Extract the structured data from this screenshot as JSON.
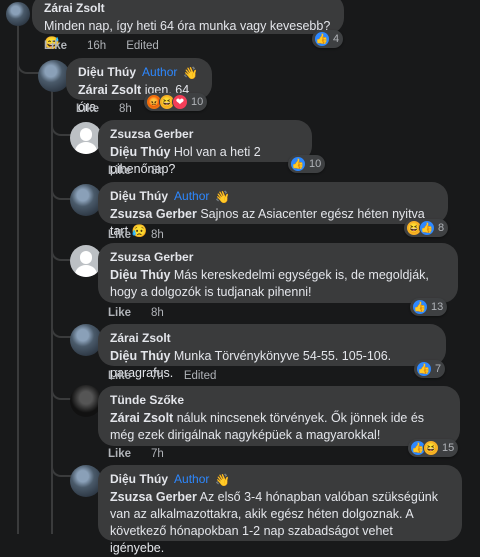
{
  "comments": [
    {
      "author": "Zárai Zsolt",
      "text": "Minden nap, így heti 64 óra munka vagy kevesebb? 😅",
      "like": "Like",
      "time": "16h",
      "edited": "Edited",
      "reaction_count": "4"
    },
    {
      "author": "Diệu Thúy",
      "badge": "Author",
      "mention": "Zárai Zsolt",
      "text": " igen, 64 óra",
      "like": "Like",
      "time": "8h",
      "reaction_count": "10"
    },
    {
      "author": "Zsuzsa Gerber",
      "mention": "Diệu Thúy",
      "text": " Hol van a heti 2 pihenőnap?",
      "like": "Like",
      "time": "8h",
      "reaction_count": "10"
    },
    {
      "author": "Diệu Thúy",
      "badge": "Author",
      "mention": "Zsuzsa Gerber",
      "text": " Sajnos az Asiacenter egész héten nyitva tart 😥",
      "like": "Like",
      "time": "8h",
      "reaction_count": "8"
    },
    {
      "author": "Zsuzsa Gerber",
      "mention": "Diệu Thúy",
      "text": " Más kereskedelmi egységek is, de megoldják, hogy a dolgozók is tudjanak pihenni!",
      "like": "Like",
      "time": "8h",
      "reaction_count": "13"
    },
    {
      "author": "Zárai Zsolt",
      "mention": "Diệu Thúy",
      "text": " Munka Törvénykönyve 54-55. 105-106. paragrafus.",
      "like": "Like",
      "time": "7h",
      "edited": "Edited",
      "reaction_count": "7"
    },
    {
      "author": "Tünde Szőke",
      "mention": "Zárai Zsolt",
      "text": " náluk nincsenek törvények. Ők jönnek ide és még ezek dirigálnak nagyképüek a magyarokkal!",
      "like": "Like",
      "time": "7h",
      "reaction_count": "15"
    },
    {
      "author": "Diệu Thúy",
      "badge": "Author",
      "mention": "Zsuzsa Gerber",
      "text": " Az első 3-4 hónapban valóban szükségünk van az alkalmazottakra, akik egész héten dolgoznak. A következő hónapokban 1-2 nap szabadságot vehet igényebe."
    }
  ],
  "icons": {
    "like_emoji": "👍",
    "haha_emoji": "😆",
    "angry_emoji": "😡",
    "love_emoji": "❤",
    "wave": "👋"
  }
}
